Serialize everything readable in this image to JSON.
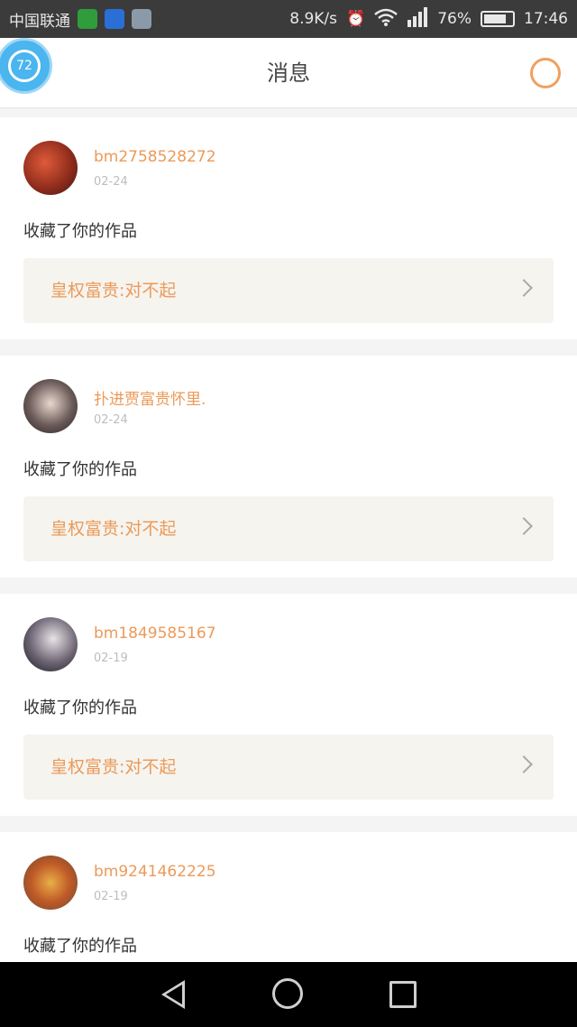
{
  "status_bar": {
    "carrier": "中国联通",
    "speed": "8.9K/s",
    "battery_percent": "76%",
    "time": "17:46",
    "icons": [
      "app-green-icon",
      "wifi-hotspot-icon",
      "gallery-icon",
      "alarm-icon",
      "wifi-icon",
      "signal-icon",
      "battery-icon"
    ]
  },
  "header": {
    "title": "消息",
    "float_ball_label": "72",
    "search_icon": "search-icon"
  },
  "messages": [
    {
      "username": "bm2758528272",
      "date": "02-24",
      "action": "收藏了你的作品",
      "work_title": "皇权富贵:对不起"
    },
    {
      "username": "扑进贾富贵怀里.",
      "date": "02-24",
      "action": "收藏了你的作品",
      "work_title": "皇权富贵:对不起"
    },
    {
      "username": "bm1849585167",
      "date": "02-19",
      "action": "收藏了你的作品",
      "work_title": "皇权富贵:对不起"
    },
    {
      "username": "bm9241462225",
      "date": "02-19",
      "action": "收藏了你的作品",
      "work_title": ""
    }
  ],
  "colors": {
    "accent": "#ec9a58",
    "status_bar_bg": "#3b3b3b",
    "work_card_bg": "#f5f4ef",
    "float_ball": "#4ab5ee"
  },
  "nav": {
    "icons": [
      "back-icon",
      "home-icon",
      "recents-icon"
    ]
  }
}
